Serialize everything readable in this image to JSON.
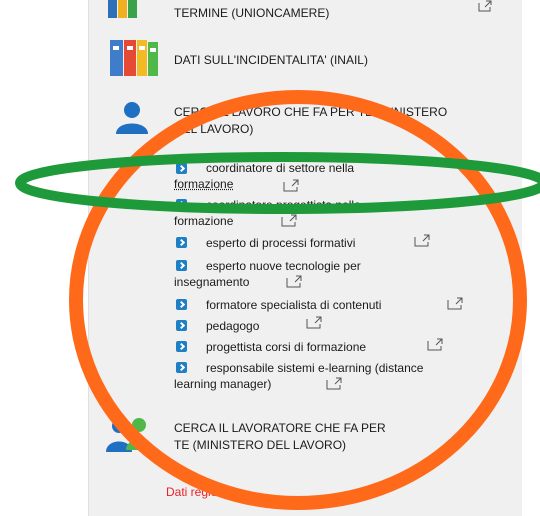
{
  "sections": {
    "top_partial": "TERMINE (UNIONCAMERE)",
    "incidentalita": "DATI SULL'INCIDENTALITA' (INAIL)",
    "cerca_lavoro_line1": "CERCA IL LAVORO CHE FA PER TE  (MINISTERO",
    "cerca_lavoro_line2": "DEL LAVORO)",
    "cerca_lavoratore_line1": "CERCA IL LAVORATORE CHE FA PER",
    "cerca_lavoratore_line2": "TE  (MINISTERO DEL LAVORO)"
  },
  "jobs": [
    {
      "line1": "coordinatore di settore nella",
      "line2": "formazione"
    },
    {
      "line1": "coordinatore progettista nella",
      "line2": "formazione"
    },
    {
      "line1": "esperto di processi formativi",
      "line2": ""
    },
    {
      "line1": "esperto nuove tecnologie per",
      "line2": "insegnamento"
    },
    {
      "line1": "formatore specialista di contenuti",
      "line2": ""
    },
    {
      "line1": "pedagogo",
      "line2": ""
    },
    {
      "line1": "progettista corsi di formazione",
      "line2": ""
    },
    {
      "line1": "responsabile sistemi e-learning (distance",
      "line2": "learning manager)"
    }
  ],
  "footer": {
    "link": "Dati regionali"
  },
  "colors": {
    "orange_ellipse": "#ff6a1a",
    "green_ellipse": "#1e9a3a",
    "bullet": "#1f7fc4",
    "link_red": "#e8242a"
  },
  "icons": [
    "binders-icon",
    "binders-icon",
    "person-icon",
    "people-icon",
    "external-link-icon",
    "chevron-right-icon"
  ]
}
